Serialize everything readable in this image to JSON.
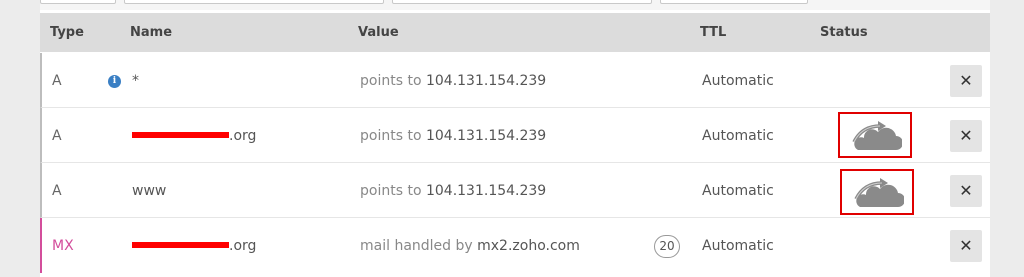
{
  "table": {
    "headers": {
      "type": "Type",
      "name": "Name",
      "value": "Value",
      "ttl": "TTL",
      "status": "Status"
    },
    "rows": [
      {
        "type": "A",
        "name": "*",
        "value_prefix": "points to",
        "value": "104.131.154.239",
        "ttl": "Automatic",
        "has_info_icon": true,
        "status_icon": null,
        "delete_label": "✕"
      },
      {
        "type": "A",
        "name_suffix": ".org",
        "name_redacted": true,
        "value_prefix": "points to",
        "value": "104.131.154.239",
        "ttl": "Automatic",
        "status_icon": "cloud-proxy-off-icon",
        "delete_label": "✕"
      },
      {
        "type": "A",
        "name": "www",
        "value_prefix": "points to",
        "value": "104.131.154.239",
        "ttl": "Automatic",
        "status_icon": "cloud-proxy-off-icon",
        "delete_label": "✕"
      },
      {
        "type": "MX",
        "name_suffix": ".org",
        "name_redacted": true,
        "value_prefix": "mail handled by",
        "value": "mx2.zoho.com",
        "priority": "20",
        "ttl": "Automatic",
        "delete_label": "✕"
      }
    ]
  },
  "colors": {
    "mx_type": "#d34d9b",
    "highlight_box": "#e00000",
    "redaction": "#ff0000",
    "info_icon": "#3a7fc4"
  }
}
